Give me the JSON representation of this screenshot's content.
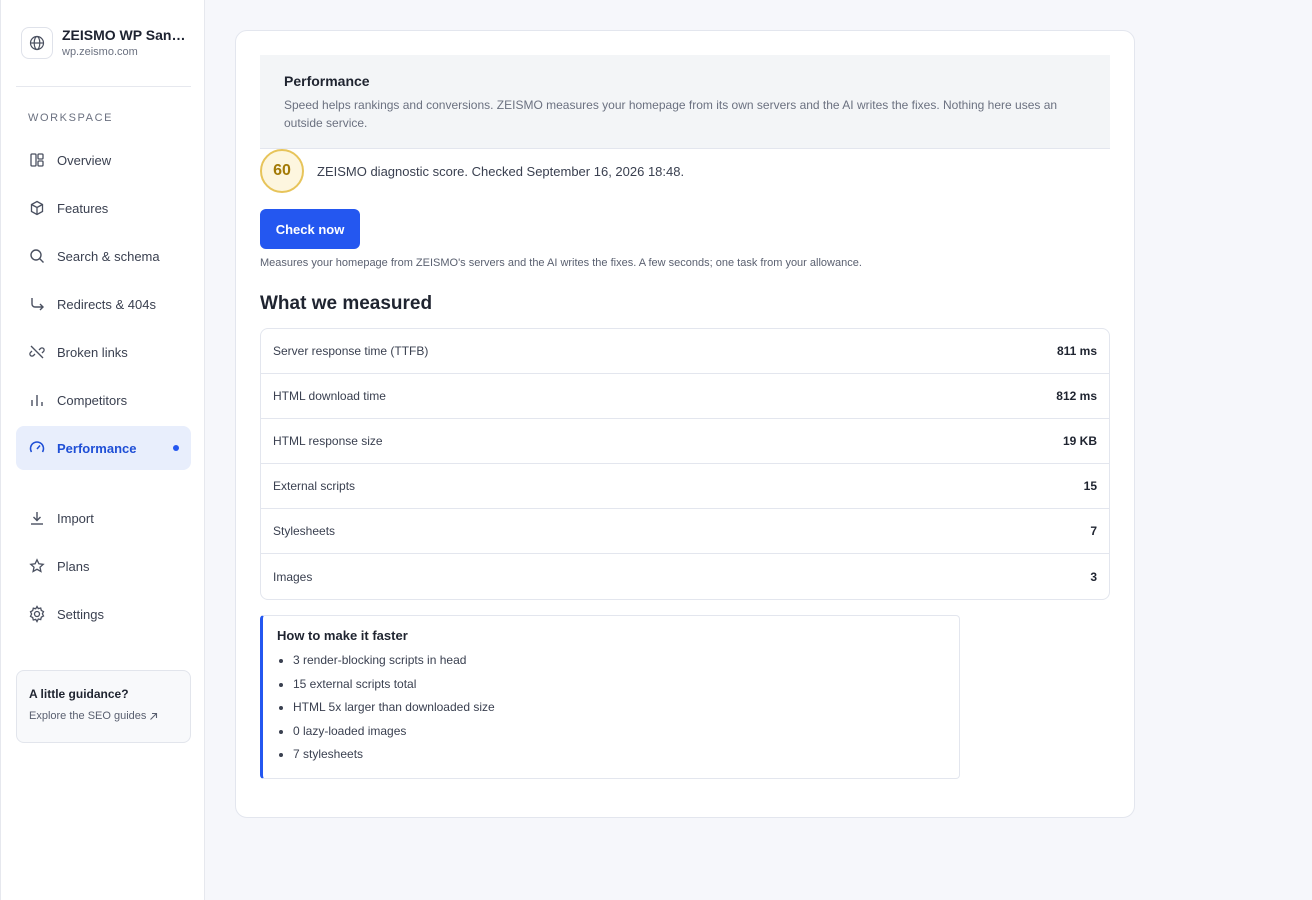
{
  "site": {
    "name": "ZEISMO WP Sandbox",
    "url": "wp.zeismo.com"
  },
  "sidebar": {
    "section_label": "WORKSPACE",
    "items": [
      {
        "label": "Overview",
        "icon": "dashboard-icon"
      },
      {
        "label": "Features",
        "icon": "cube-icon"
      },
      {
        "label": "Search & schema",
        "icon": "search-icon"
      },
      {
        "label": "Redirects & 404s",
        "icon": "redirect-arrow-icon"
      },
      {
        "label": "Broken links",
        "icon": "broken-link-icon"
      },
      {
        "label": "Competitors",
        "icon": "bar-chart-icon"
      },
      {
        "label": "Performance",
        "icon": "gauge-icon",
        "active": true
      }
    ],
    "secondary_items": [
      {
        "label": "Import",
        "icon": "download-icon"
      },
      {
        "label": "Plans",
        "icon": "star-icon"
      },
      {
        "label": "Settings",
        "icon": "gear-icon"
      }
    ],
    "guide": {
      "title": "A little guidance?",
      "link": "Explore the SEO guides"
    }
  },
  "main": {
    "title": "Performance",
    "description": "Speed helps rankings and conversions. ZEISMO measures your homepage from its own servers and the AI writes the fixes. Nothing here uses an outside service.",
    "score": "60",
    "score_text": "ZEISMO diagnostic score. Checked September 16, 2026 18:48.",
    "check_button": "Check now",
    "check_note": "Measures your homepage from ZEISMO's servers and the AI writes the fixes. A few seconds; one task from your allowance.",
    "measured_title": "What we measured",
    "metrics": [
      {
        "label": "Server response time (TTFB)",
        "value": "811 ms"
      },
      {
        "label": "HTML download time",
        "value": "812 ms"
      },
      {
        "label": "HTML response size",
        "value": "19 KB"
      },
      {
        "label": "External scripts",
        "value": "15"
      },
      {
        "label": "Stylesheets",
        "value": "7"
      },
      {
        "label": "Images",
        "value": "3"
      }
    ],
    "tips_title": "How to make it faster",
    "tips": [
      "3 render-blocking scripts in head",
      "15 external scripts total",
      "HTML 5x larger than downloaded size",
      "0 lazy-loaded images",
      "7 stylesheets"
    ]
  },
  "colors": {
    "accent": "#2457f0",
    "score_ring": "#e7c45a",
    "score_text": "#a37a06"
  }
}
